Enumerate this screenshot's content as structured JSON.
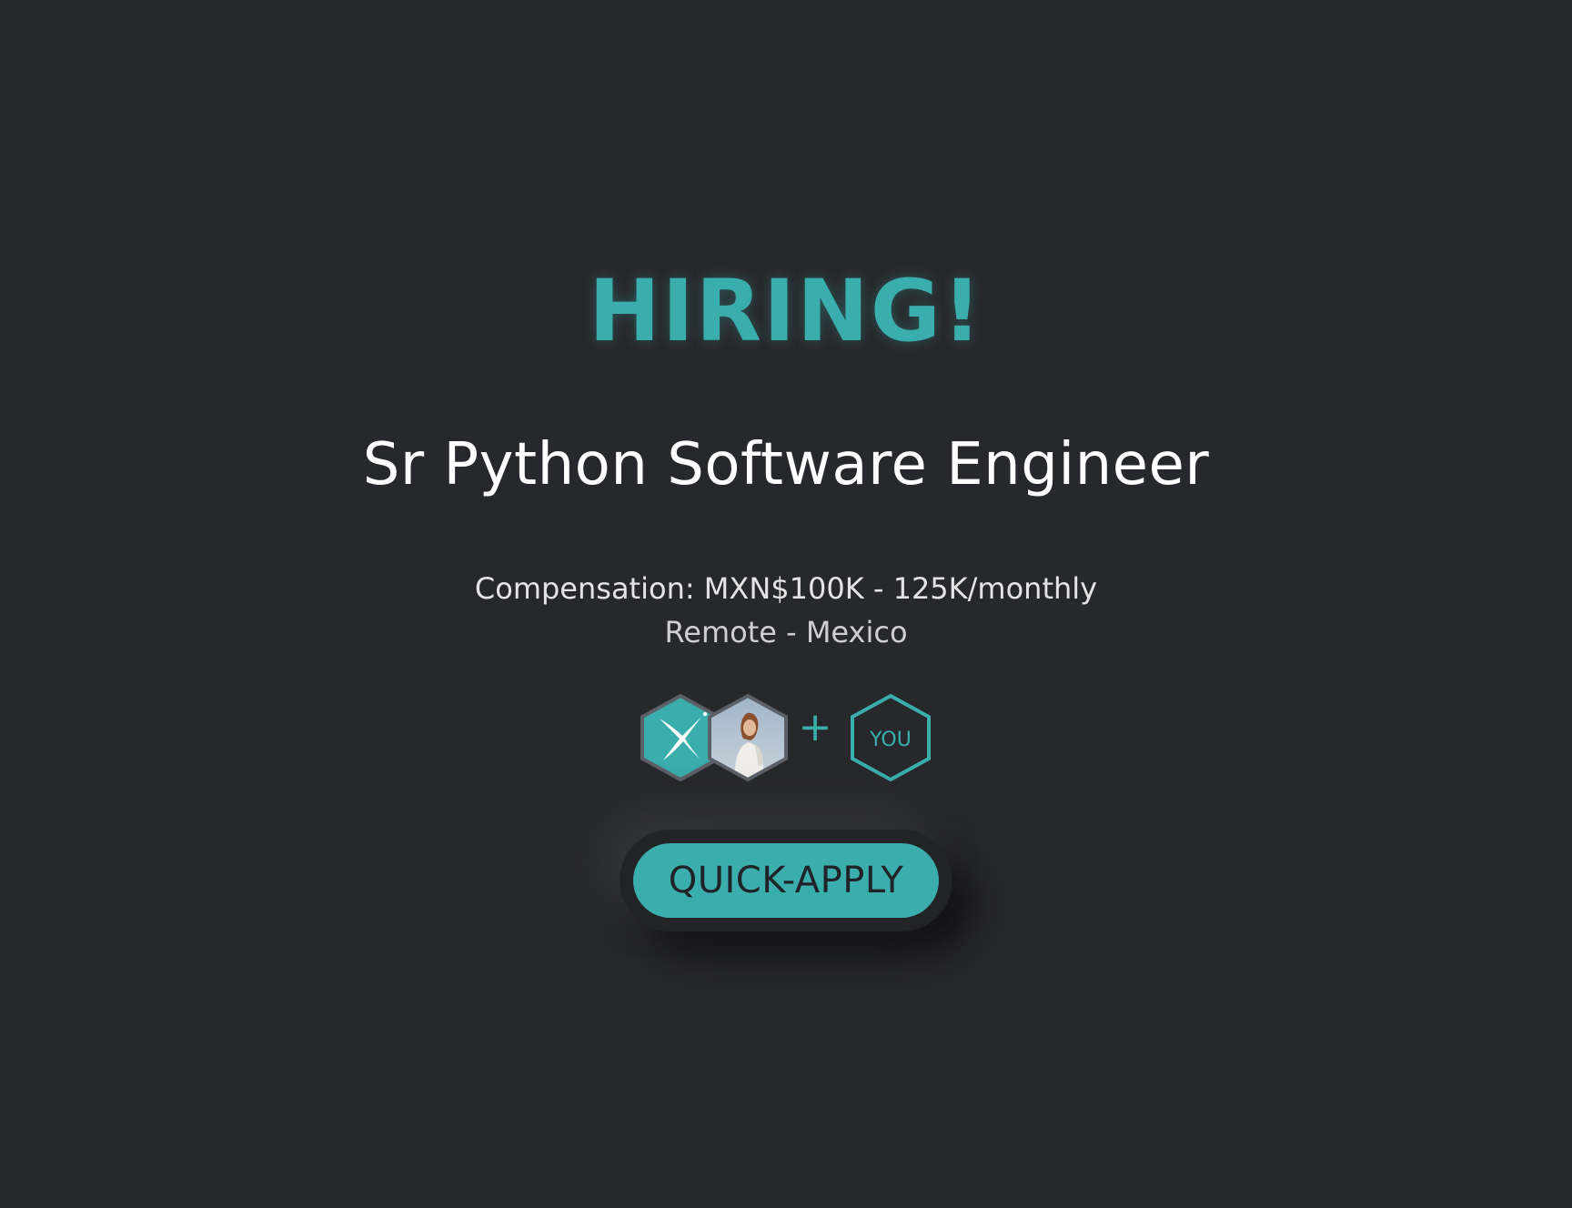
{
  "banner": {
    "headline": "HIRING!",
    "job_title": "Sr Python Software Engineer",
    "compensation": "Compensation: MXN$100K - 125K/monthly",
    "location": "Remote - Mexico"
  },
  "team": {
    "plus_sign": "+",
    "you_label": "YOU",
    "icons": [
      "company-logo-icon",
      "recruiter-avatar",
      "you-hexagon-icon"
    ]
  },
  "cta": {
    "label": "QUICK-APPLY"
  },
  "colors": {
    "background": "#27282c",
    "accent": "#3aadad",
    "title_text": "#ffffff",
    "meta_text": "#e4e4e4",
    "hex_border": "#5c6069"
  }
}
